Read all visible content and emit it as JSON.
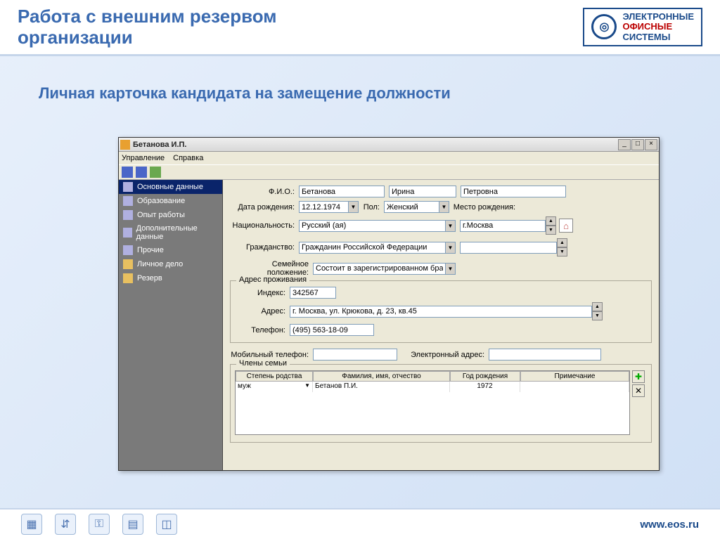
{
  "slide": {
    "title_line1": "Работа с внешним резервом",
    "title_line2": "организации",
    "subtitle": "Личная карточка кандидата на замещение должности",
    "logo_line1": "ЭЛЕКТРОННЫЕ",
    "logo_line2": "ОФИСНЫЕ",
    "logo_line3": "СИСТЕМЫ",
    "footer_url": "www.eos.ru"
  },
  "window": {
    "title": "Бетанова И.П.",
    "menu": {
      "manage": "Управление",
      "help": "Справка"
    }
  },
  "sidebar": {
    "items": [
      {
        "label": "Основные данные",
        "active": true
      },
      {
        "label": "Образование"
      },
      {
        "label": "Опыт работы"
      },
      {
        "label": "Дополнительные данные"
      },
      {
        "label": "Прочие"
      },
      {
        "label": "Личное дело"
      },
      {
        "label": "Резерв"
      }
    ]
  },
  "labels": {
    "fio": "Ф.И.О.:",
    "dob": "Дата рождения:",
    "sex": "Пол:",
    "pob": "Место рождения:",
    "nationality": "Национальность:",
    "citizenship": "Гражданство:",
    "marital": "Семейное положение:",
    "address_group": "Адрес проживания",
    "index": "Индекс:",
    "address": "Адрес:",
    "phone": "Телефон:",
    "mobile": "Мобильный телефон:",
    "email": "Электронный адрес:",
    "family_group": "Члены семьи"
  },
  "fields": {
    "surname": "Бетанова",
    "name": "Ирина",
    "patronymic": "Петровна",
    "dob": "12.12.1974",
    "sex": "Женский",
    "pob": "г.Москва",
    "nationality": "Русский (ая)",
    "citizenship": "Гражданин Российской Федерации",
    "marital": "Состоит в зарегистрированном браке",
    "index": "342567",
    "address": "г. Москва, ул. Крюкова, д. 23, кв.45",
    "phone": "(495) 563-18-09",
    "mobile": "",
    "email": ""
  },
  "family": {
    "headers": {
      "relation": "Степень родства",
      "fio": "Фамилия, имя, отчество",
      "year": "Год рождения",
      "note": "Примечание"
    },
    "rows": [
      {
        "relation": "муж",
        "fio": "Бетанов П.И.",
        "year": "1972",
        "note": ""
      }
    ]
  }
}
